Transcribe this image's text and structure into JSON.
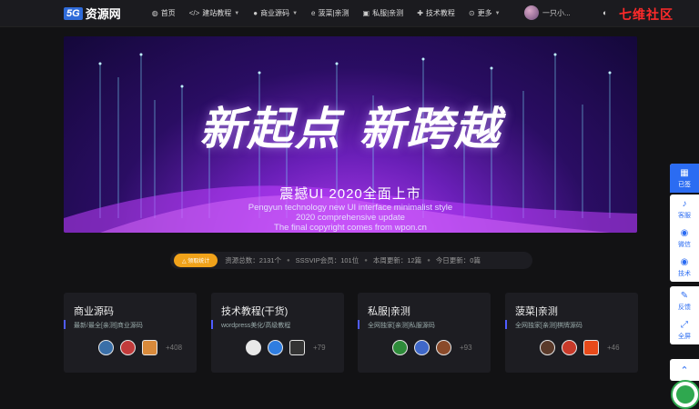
{
  "header": {
    "logo_badge": "5G",
    "logo_text": "资源网",
    "nav": [
      {
        "icon": "◍",
        "icon_name": "home-icon",
        "label": "首页",
        "dropdown": false
      },
      {
        "icon": "</>",
        "icon_name": "code-icon",
        "label": "建站教程",
        "dropdown": true
      },
      {
        "icon": "",
        "icon_name": "apple-icon",
        "label": "商业源码",
        "dropdown": true
      },
      {
        "icon": "e",
        "icon_name": "edge-icon",
        "label": "菠菜|亲测",
        "dropdown": false
      },
      {
        "icon": "▣",
        "icon_name": "server-icon",
        "label": "私服|亲测",
        "dropdown": false
      },
      {
        "icon": "✚",
        "icon_name": "tools-icon",
        "label": "技术教程",
        "dropdown": false
      },
      {
        "icon": "⊙",
        "icon_name": "more-icon",
        "label": "更多",
        "dropdown": true
      }
    ],
    "user_name": "一只小...",
    "theme_icon": "◐",
    "brand_mark": "七维社区"
  },
  "banner": {
    "title": "新起点 新跨越",
    "subtitle": "震撼UI 2020全面上市",
    "line1": "Pengyun technology new UI interface minimalist style",
    "line2": "2020 comprehensive update",
    "line3": "The final copyright comes from wpon.cn"
  },
  "stats": {
    "button": "△ 领取统计",
    "total": "资源总数：2131个",
    "vip": "SSSVIP会员：101位",
    "week": "本周更新：12篇",
    "today": "今日更新：0篇"
  },
  "cards": [
    {
      "title": "商业源码",
      "desc": "最新/最全[亲测]商业源码",
      "count": "+408",
      "thumbs": [
        "#3a6fa8",
        "#c23b3b",
        "#d98a3b"
      ]
    },
    {
      "title": "技术教程(干货)",
      "desc": "wordpress美化/高级教程",
      "count": "+79",
      "thumbs": [
        "#e8e8e8",
        "#2f7de0",
        "#333333"
      ]
    },
    {
      "title": "私服|亲测",
      "desc": "全网独家[亲测]私服源码",
      "count": "+93",
      "thumbs": [
        "#2e8b3a",
        "#3f68c9",
        "#8a4a2a"
      ]
    },
    {
      "title": "菠菜|亲测",
      "desc": "全网独家[亲测]棋牌源码",
      "count": "+46",
      "thumbs": [
        "#5a3a2a",
        "#c83a2a",
        "#e84a1a"
      ]
    }
  ],
  "sidebar": [
    {
      "icon": "▦",
      "icon_name": "calendar-icon",
      "label": "已签",
      "active": true
    },
    {
      "icon": "🔔",
      "icon_name": "bell-icon",
      "label": "客服",
      "active": false
    },
    {
      "icon": "◉",
      "icon_name": "wechat-icon",
      "label": "微信",
      "active": false
    },
    {
      "icon": "◉",
      "icon_name": "chat-icon",
      "label": "技术",
      "active": false
    },
    {
      "icon": "✎",
      "icon_name": "edit-icon",
      "label": "反馈",
      "active": false
    },
    {
      "icon": "⤢",
      "icon_name": "fullscreen-icon",
      "label": "全屏",
      "active": false
    }
  ],
  "back_to_top_icon": "⌃"
}
